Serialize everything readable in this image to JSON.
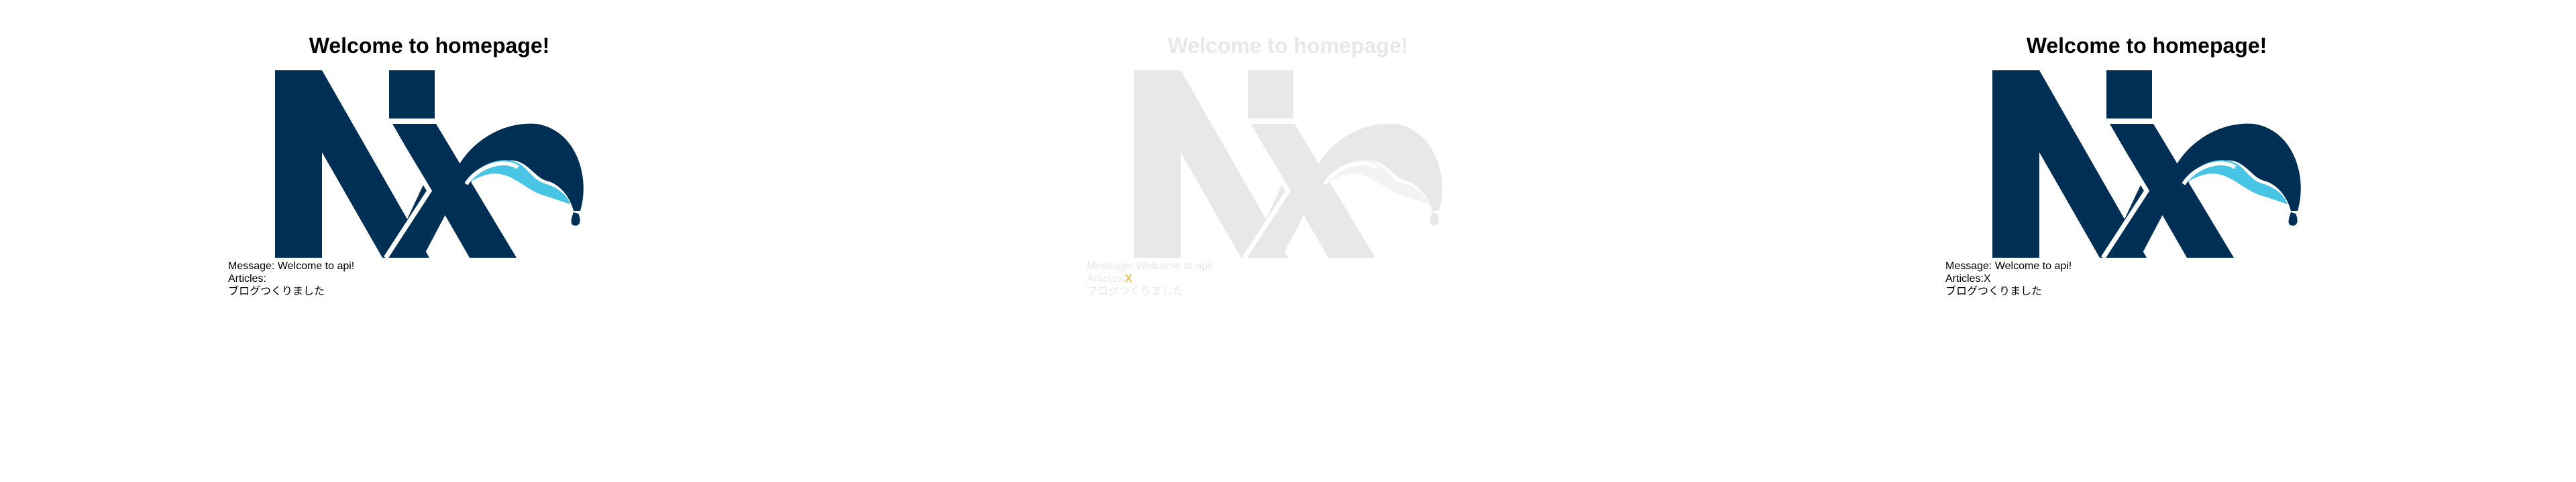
{
  "colors": {
    "logo_dark": "#002f56",
    "logo_wave": "#48c4e5",
    "faded_text": "#e8e8e8",
    "accent_x": "#f0a30a"
  },
  "frames": [
    {
      "title": "Welcome to homepage!",
      "logo_icon": "nx-logo-icon",
      "message_label": "Message: ",
      "message_value": "Welcome to api!",
      "articles_label": "Articles:",
      "articles_input": "",
      "blog_text": "ブログつくりました"
    },
    {
      "title": "Welcome to homepage!",
      "logo_icon": "nx-logo-icon",
      "message_label": "Message: ",
      "message_value": "Welcome to api!",
      "articles_label": "Articles:",
      "articles_input": "X",
      "blog_text": "ブログつくりました"
    },
    {
      "title": "Welcome to homepage!",
      "logo_icon": "nx-logo-icon",
      "message_label": "Message: ",
      "message_value": "Welcome to api!",
      "articles_label": "Articles:",
      "articles_input": "X",
      "blog_text": "ブログつくりました"
    }
  ]
}
